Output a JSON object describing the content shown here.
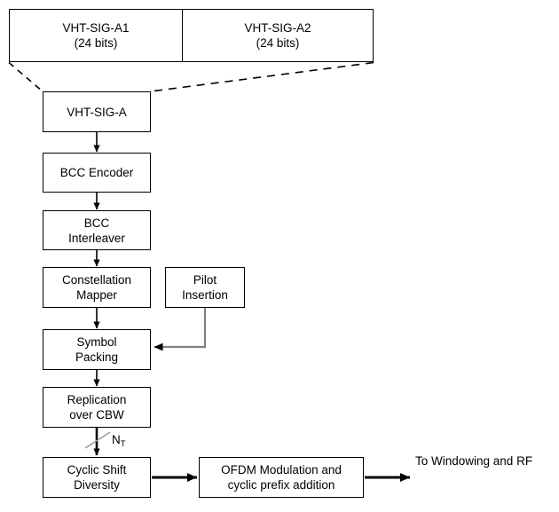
{
  "diagram": {
    "title_boxes": [
      {
        "name": "vht-sig-a1",
        "label": "VHT-SIG-A1\n(24 bits)"
      },
      {
        "name": "vht-sig-a2",
        "label": "VHT-SIG-A2\n(24 bits)"
      }
    ],
    "blocks": [
      {
        "name": "vht-sig-a",
        "label": "VHT-SIG-A"
      },
      {
        "name": "bcc-encoder",
        "label": "BCC Encoder"
      },
      {
        "name": "bcc-interleaver",
        "label": "BCC\nInterleaver"
      },
      {
        "name": "constellation-mapper",
        "label": "Constellation\nMapper"
      },
      {
        "name": "pilot-insertion",
        "label": "Pilot\nInsertion"
      },
      {
        "name": "symbol-packing",
        "label": "Symbol\nPacking"
      },
      {
        "name": "replication-over-cbw",
        "label": "Replication\nover CBW"
      },
      {
        "name": "cyclic-shift-diversity",
        "label": "Cyclic Shift\nDiversity"
      },
      {
        "name": "ofdm-modulation",
        "label": "OFDM Modulation and\ncyclic prefix addition"
      }
    ],
    "annotations": {
      "stream_count": "N",
      "stream_count_sub": "T",
      "output_text": "To Windowing and RF"
    },
    "colors": {
      "line": "#000000",
      "pilot_arrow": "#808080",
      "slash": "#999999",
      "background": "#ffffff"
    }
  }
}
